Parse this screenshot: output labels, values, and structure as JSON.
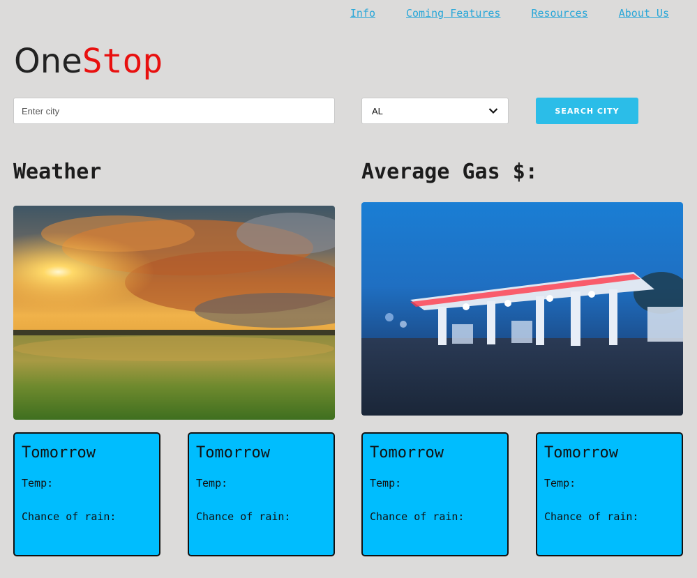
{
  "nav": {
    "items": [
      {
        "label": "Info"
      },
      {
        "label": "Coming Features"
      },
      {
        "label": "Resources"
      },
      {
        "label": "About Us"
      }
    ]
  },
  "logo": {
    "part1": "One",
    "part2": "Stop"
  },
  "search": {
    "city_placeholder": "Enter city",
    "city_value": "",
    "state_selected": "AL",
    "button_label": "SEARCH CITY"
  },
  "sections": {
    "weather_title": "Weather",
    "gas_title": "Average Gas $:"
  },
  "cards": [
    {
      "title": "Tomorrow",
      "temp_label": "Temp:",
      "rain_label": "Chance of rain:"
    },
    {
      "title": "Tomorrow",
      "temp_label": "Temp:",
      "rain_label": "Chance of rain:"
    },
    {
      "title": "Tomorrow",
      "temp_label": "Temp:",
      "rain_label": "Chance of rain:"
    },
    {
      "title": "Tomorrow",
      "temp_label": "Temp:",
      "rain_label": "Chance of rain:"
    }
  ],
  "colors": {
    "background": "#dcdbda",
    "link": "#2aa7d8",
    "logo_accent": "#e8100f",
    "button": "#2bbde8",
    "card": "#00bdfe"
  },
  "icons": {
    "select_arrow": "chevron-down-icon"
  }
}
